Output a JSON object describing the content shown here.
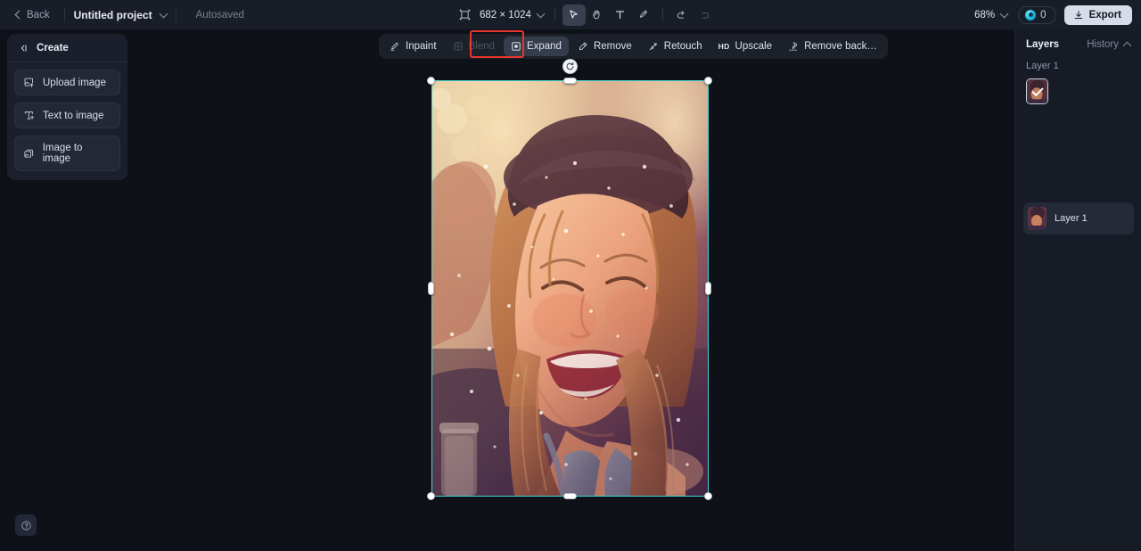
{
  "header": {
    "back_label": "Back",
    "project_name": "Untitled project",
    "autosave_status": "Autosaved",
    "canvas_size": "682 × 1024",
    "zoom_level": "68%",
    "credits_count": "0",
    "export_label": "Export",
    "tools": [
      {
        "name": "select-tool",
        "icon": "cursor-icon",
        "active": true
      },
      {
        "name": "hand-tool",
        "icon": "hand-icon",
        "active": false
      },
      {
        "name": "text-tool",
        "icon": "text-icon",
        "active": false
      },
      {
        "name": "brush-tool",
        "icon": "brush-icon",
        "active": false
      }
    ],
    "undo_label": "Undo",
    "redo_label": "Redo"
  },
  "left_panel": {
    "title": "Create",
    "items": [
      {
        "label": "Upload image",
        "icon": "upload-image-icon"
      },
      {
        "label": "Text to image",
        "icon": "text-to-image-icon"
      },
      {
        "label": "Image to image",
        "icon": "image-to-image-icon"
      }
    ]
  },
  "edit_toolbar": {
    "items": [
      {
        "label": "Inpaint",
        "icon": "inpaint-icon",
        "state": "default"
      },
      {
        "label": "Blend",
        "icon": "blend-icon",
        "state": "disabled"
      },
      {
        "label": "Expand",
        "icon": "expand-icon",
        "state": "active"
      },
      {
        "label": "Remove",
        "icon": "remove-icon",
        "state": "default"
      },
      {
        "label": "Retouch",
        "icon": "retouch-icon",
        "state": "default"
      },
      {
        "label": "Upscale",
        "icon": "hd-icon",
        "state": "default",
        "prefix": "HD"
      },
      {
        "label": "Remove back…",
        "icon": "remove-background-icon",
        "state": "default"
      }
    ],
    "highlight_color": "#e8352e",
    "highlighted_item": "Expand"
  },
  "right_panel": {
    "tab_layers": "Layers",
    "tab_history": "History",
    "history_group_label": "Layer 1",
    "layers": [
      {
        "name": "Layer 1"
      }
    ]
  },
  "canvas": {
    "selection_color": "#41d6d9",
    "rotate_icon": "rotate-icon",
    "image_description": "Portrait of a smiling woman wearing a hat"
  },
  "footer": {
    "help_label": "Help"
  }
}
